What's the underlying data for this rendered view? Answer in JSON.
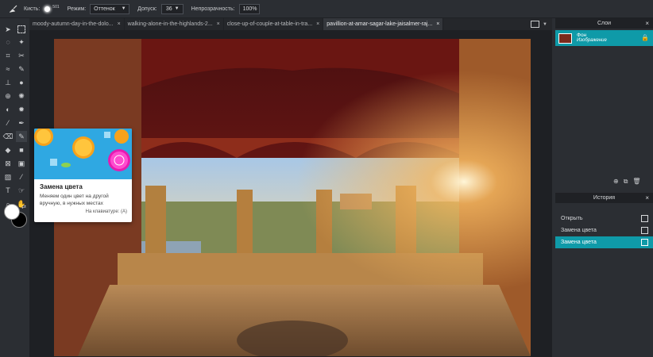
{
  "toolbar": {
    "brush_label": "Кисть:",
    "brush_size": "501",
    "mode_label": "Режим:",
    "mode_value": "Оттенок",
    "tolerance_label": "Допуск:",
    "tolerance_value": "36",
    "opacity_label": "Непрозрачность:",
    "opacity_value": "100%"
  },
  "tabs": [
    {
      "label": "moody-autumn-day-in-the-dolo..."
    },
    {
      "label": "walking-alone-in-the-highlands-2..."
    },
    {
      "label": "close-up-of-couple-at-table-in-tra..."
    },
    {
      "label": "pavillion-at-amar-sagar-lake-jaisalmer-raj..."
    }
  ],
  "tooltip": {
    "title": "Замена цвета",
    "description": "Меняем один цвет на другой вручную, в нужных местах",
    "shortcut": "На клавиатуре: (A)"
  },
  "layers_panel": {
    "title": "Слои",
    "layer_name": "Фон",
    "layer_type": "Изображение"
  },
  "history_panel": {
    "title": "История",
    "items": [
      "Открыть",
      "Замена цвета",
      "Замена цвета"
    ]
  },
  "colors": {
    "foreground": "#ffffff",
    "background": "#000000",
    "accent": "#0f9aa8"
  }
}
